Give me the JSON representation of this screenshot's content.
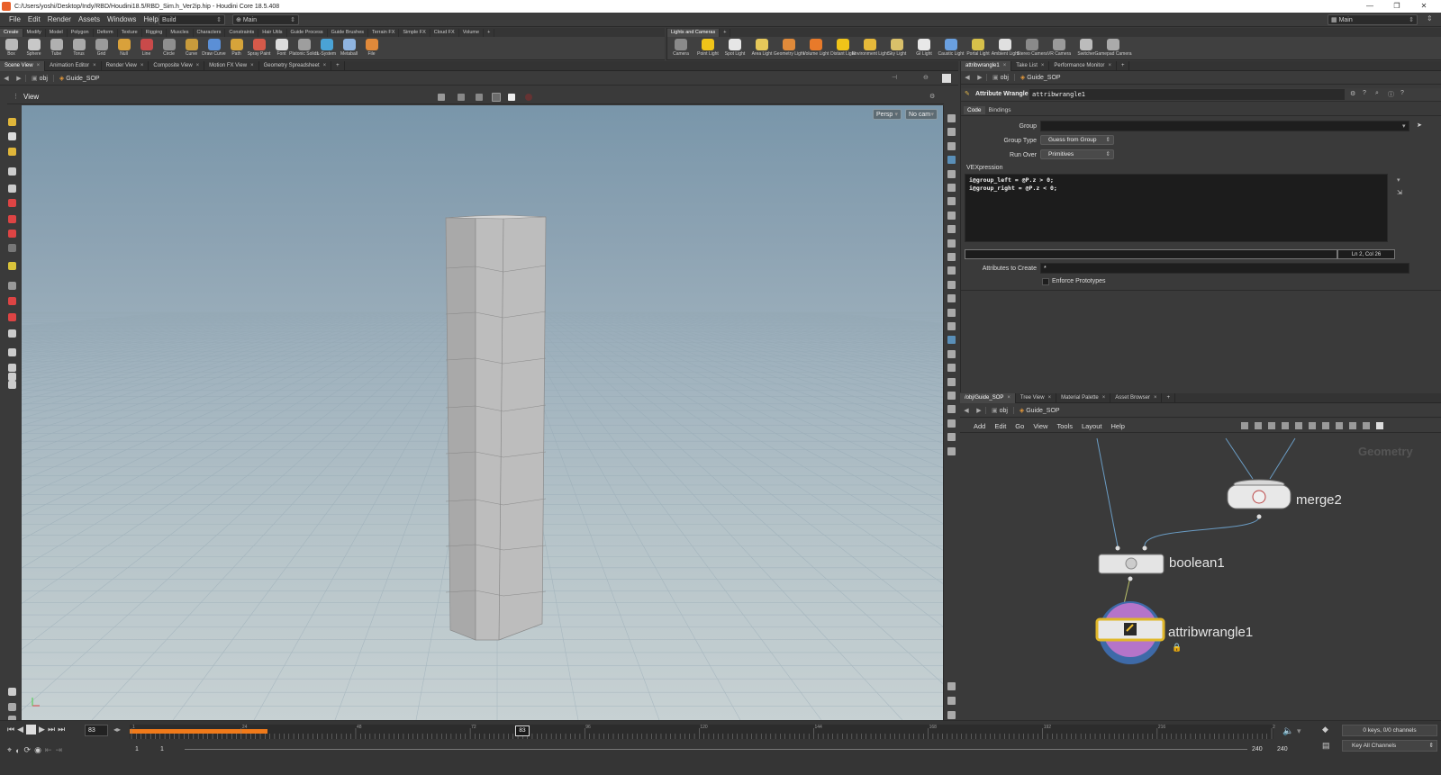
{
  "window": {
    "title": "C:/Users/yoshi/Desktop/Indy/RBD/Houdini18.5/RBD_Sim.h_Ver2ip.hip - Houdini Core 18.5.408",
    "controls": [
      "—",
      "❐",
      "✕"
    ]
  },
  "menubar": {
    "items": [
      "File",
      "Edit",
      "Render",
      "Assets",
      "Windows",
      "Help"
    ],
    "desktop": "Build",
    "layout": "Main",
    "right_desktop": "Main"
  },
  "shelf_left": {
    "tabs": [
      "Create",
      "Modify",
      "Model",
      "Polygon",
      "Deform",
      "Texture",
      "Rigging",
      "Muscles",
      "Characters",
      "Constraints",
      "Hair Utils",
      "Guide Process",
      "Guide Brushes",
      "Terrain FX",
      "Simple FX",
      "Cloud FX",
      "Volume"
    ],
    "tools": [
      {
        "label": "Box",
        "icon": "box-icon",
        "color": "#b9b9b9"
      },
      {
        "label": "Sphere",
        "icon": "sphere-icon",
        "color": "#c8c8c8"
      },
      {
        "label": "Tube",
        "icon": "tube-icon",
        "color": "#b0b0b0"
      },
      {
        "label": "Torus",
        "icon": "torus-icon",
        "color": "#a9a9a9"
      },
      {
        "label": "Grid",
        "icon": "grid-icon",
        "color": "#9a9a9a"
      },
      {
        "label": "Null",
        "icon": "null-icon",
        "color": "#d9a13b"
      },
      {
        "label": "Line",
        "icon": "line-icon",
        "color": "#c94a4a"
      },
      {
        "label": "Circle",
        "icon": "circle-icon",
        "color": "#8f8f8f"
      },
      {
        "label": "Curve",
        "icon": "curve-icon",
        "color": "#c89b3c"
      },
      {
        "label": "Draw Curve",
        "icon": "draw-curve-icon",
        "color": "#5b8fd6"
      },
      {
        "label": "Path",
        "icon": "path-icon",
        "color": "#d6a43a"
      },
      {
        "label": "Spray Paint",
        "icon": "spray-paint-icon",
        "color": "#d65a4a"
      },
      {
        "label": "Font",
        "icon": "font-icon",
        "color": "#dddddd"
      },
      {
        "label": "Platonic Solids",
        "icon": "platonic-icon",
        "color": "#9e9e9e"
      },
      {
        "label": "L-System",
        "icon": "l-system-icon",
        "color": "#4aa3d6"
      },
      {
        "label": "Metaball",
        "icon": "metaball-icon",
        "color": "#8fb4e0"
      },
      {
        "label": "File",
        "icon": "file-icon",
        "color": "#e0893a"
      }
    ]
  },
  "shelf_right": {
    "tabs": [
      "Lights and Cameras"
    ],
    "tools": [
      {
        "label": "Camera",
        "icon": "camera-icon",
        "color": "#8a8a8a"
      },
      {
        "label": "Point Light",
        "icon": "point-light-icon",
        "color": "#f0c419"
      },
      {
        "label": "Spot Light",
        "icon": "spot-light-icon",
        "color": "#e6e6e6"
      },
      {
        "label": "Area Light",
        "icon": "area-light-icon",
        "color": "#e6c85a"
      },
      {
        "label": "Geometry Light",
        "icon": "geometry-light-icon",
        "color": "#e08a3a"
      },
      {
        "label": "Volume Light",
        "icon": "volume-light-icon",
        "color": "#e87a2a"
      },
      {
        "label": "Distant Light",
        "icon": "distant-light-icon",
        "color": "#f0c419"
      },
      {
        "label": "Environment Light",
        "icon": "environment-light-icon",
        "color": "#e6b93a"
      },
      {
        "label": "Sky Light",
        "icon": "sky-light-icon",
        "color": "#d9c06a"
      },
      {
        "label": "GI Light",
        "icon": "gi-light-icon",
        "color": "#e8e8e8"
      },
      {
        "label": "Caustic Light",
        "icon": "caustic-light-icon",
        "color": "#6aa0e0"
      },
      {
        "label": "Portal Light",
        "icon": "portal-light-icon",
        "color": "#d6c04a"
      },
      {
        "label": "Ambient Light",
        "icon": "ambient-light-icon",
        "color": "#e0e0e0"
      },
      {
        "label": "Stereo Camera",
        "icon": "stereo-camera-icon",
        "color": "#8a8a8a"
      },
      {
        "label": "VR Camera",
        "icon": "vr-camera-icon",
        "color": "#9a9a9a"
      },
      {
        "label": "Switcher",
        "icon": "switcher-icon",
        "color": "#bcbcbc"
      },
      {
        "label": "Gamepad Camera",
        "icon": "gamepad-camera-icon",
        "color": "#aaaaaa"
      }
    ]
  },
  "left_pane": {
    "tabs": [
      "Scene View",
      "Animation Editor",
      "Render View",
      "Composite View",
      "Motion FX View",
      "Geometry Spreadsheet"
    ],
    "path": [
      "obj",
      "Guide_SOP"
    ],
    "view_label": "View",
    "persp": "Persp",
    "cam": "No cam"
  },
  "params_pane": {
    "tabs": [
      "attribwrangle1",
      "Take List",
      "Performance Monitor"
    ],
    "path": [
      "obj",
      "Guide_SOP"
    ],
    "node_type": "Attribute Wrangle",
    "node_name": "attribwrangle1",
    "subtabs": [
      "Code",
      "Bindings"
    ],
    "group_label": "Group",
    "group_value": "",
    "group_type_label": "Group Type",
    "group_type_value": "Guess from Group",
    "run_over_label": "Run Over",
    "run_over_value": "Primitives",
    "vex_label": "VEXpression",
    "code_lines": [
      "i@group_left = @P.z > 0;",
      "i@group_right = @P.z < 0;"
    ],
    "status": "Ln 2, Col 26",
    "attr_create_label": "Attributes to Create",
    "attr_create_value": "*",
    "enforce_label": "Enforce Prototypes"
  },
  "network_pane": {
    "tabs": [
      "/obj/Guide_SOP",
      "Tree View",
      "Material Palette",
      "Asset Browser"
    ],
    "path": [
      "obj",
      "Guide_SOP"
    ],
    "menu": [
      "Add",
      "Edit",
      "Go",
      "View",
      "Tools",
      "Layout",
      "Help"
    ],
    "context": "Geometry",
    "nodes": [
      "merge2",
      "boolean1",
      "attribwrangle1"
    ]
  },
  "timeline": {
    "frame": "83",
    "ticks": [
      "1",
      "24",
      "48",
      "72",
      "96",
      "120",
      "144",
      "168",
      "192",
      "216",
      "2"
    ],
    "current": "83",
    "start": "1",
    "start2": "1",
    "end": "240",
    "end2": "240",
    "keys": "0 keys, 0/0 channels",
    "key_all": "Key All Channels"
  }
}
